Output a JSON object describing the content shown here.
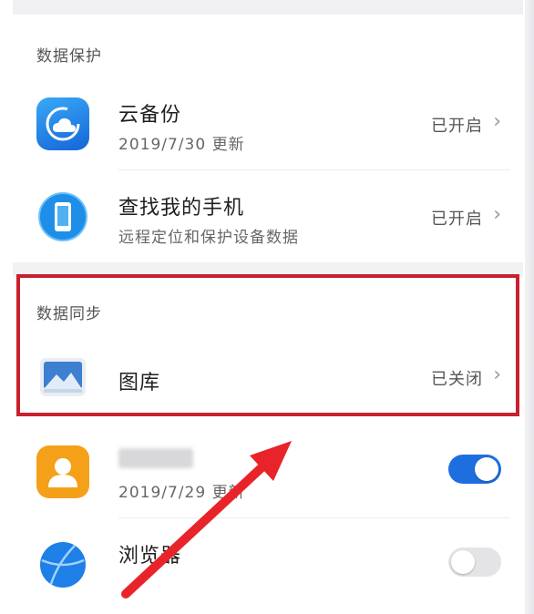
{
  "sections": {
    "protection": {
      "title": "数据保护"
    },
    "sync": {
      "title": "数据同步"
    }
  },
  "rows": {
    "cloud_backup": {
      "title": "云备份",
      "subtitle": "2019/7/30 更新",
      "status": "已开启"
    },
    "find_phone": {
      "title": "查找我的手机",
      "subtitle": "远程定位和保护设备数据",
      "status": "已开启"
    },
    "gallery": {
      "title": "图库",
      "status": "已关闭"
    },
    "contacts": {
      "subtitle": "2019/7/29 更新",
      "toggle": "on"
    },
    "browser": {
      "title": "浏览器",
      "toggle": "off"
    }
  },
  "icons": {
    "chevron": "chevron-right-icon",
    "cloud_backup": "cloud-backup-icon",
    "find_phone": "phone-icon",
    "gallery": "gallery-icon",
    "contacts": "contacts-icon",
    "browser": "browser-icon"
  },
  "colors": {
    "accent_blue": "#1d6fe0",
    "highlight_red": "#c8202e",
    "arrow_red": "#e8242a",
    "contacts_orange": "#f5a019"
  }
}
